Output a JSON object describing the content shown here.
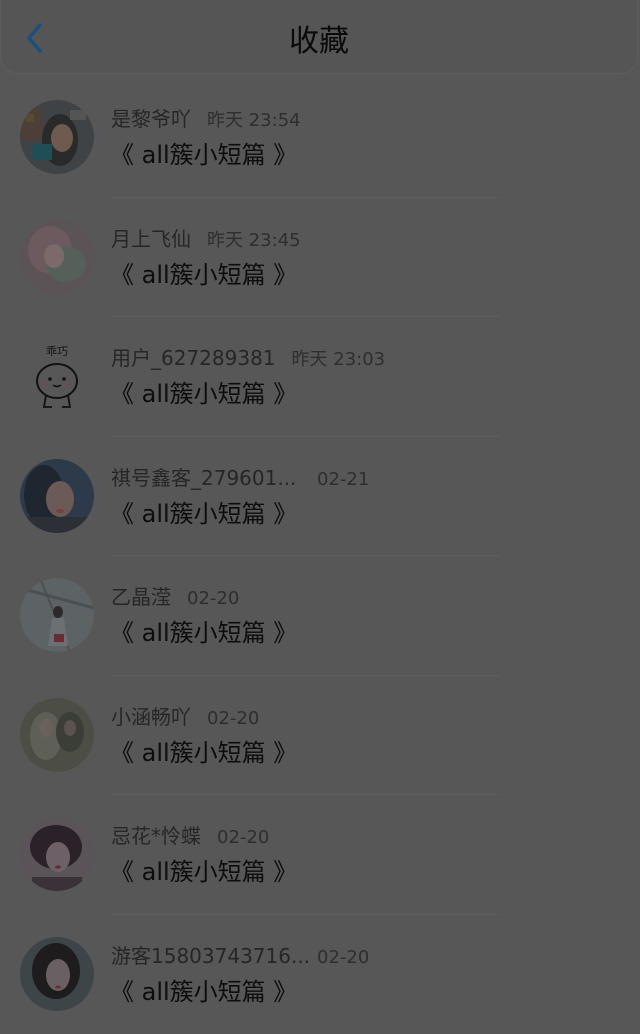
{
  "header": {
    "title": "收藏"
  },
  "items": [
    {
      "name": "是黎爷吖",
      "time": "昨天 23:54",
      "doc": "《 all簇小短篇 》"
    },
    {
      "name": "月上飞仙",
      "time": "昨天 23:45",
      "doc": "《 all簇小短篇 》"
    },
    {
      "name": "用户_627289381",
      "time": "昨天 23:03",
      "doc": "《 all簇小短篇 》",
      "avatar_caption": "乖巧"
    },
    {
      "name": "祺号鑫客_279601...",
      "time": "02-21",
      "doc": "《 all簇小短篇 》"
    },
    {
      "name": "乙晶滢",
      "time": "02-20",
      "doc": "《 all簇小短篇 》"
    },
    {
      "name": "小涵畅吖",
      "time": "02-20",
      "doc": "《 all簇小短篇 》"
    },
    {
      "name": "忌花*怜蝶",
      "time": "02-20",
      "doc": "《 all簇小短篇 》"
    },
    {
      "name": "游客15803743716...",
      "time": "02-20",
      "doc": "《 all簇小短篇 》"
    }
  ],
  "colors": {
    "back_arrow": "#1a4f7e"
  }
}
